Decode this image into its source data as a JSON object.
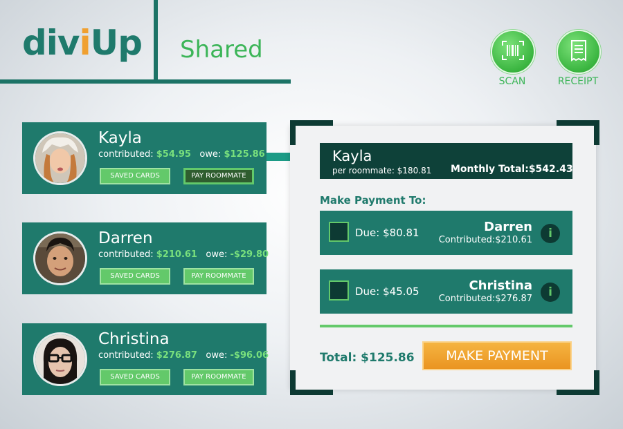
{
  "header": {
    "logo": {
      "part1": "div",
      "accent": "i",
      "part2": "Up"
    },
    "title": "Shared",
    "scan_label": "SCAN",
    "receipt_label": "RECEIPT"
  },
  "roommates": [
    {
      "name": "Kayla",
      "contributed_label": "contributed:",
      "contributed": "$54.95",
      "owe_label": "owe:",
      "owe": "$125.86",
      "saved_cards": "SAVED CARDS",
      "pay_roommate": "PAY ROOMMATE"
    },
    {
      "name": "Darren",
      "contributed_label": "contributed:",
      "contributed": "$210.61",
      "owe_label": "owe:",
      "owe": "-$29.80",
      "saved_cards": "SAVED CARDS",
      "pay_roommate": "PAY ROOMMATE"
    },
    {
      "name": "Christina",
      "contributed_label": "contributed:",
      "contributed": "$276.87",
      "owe_label": "owe:",
      "owe": "-$96.06",
      "saved_cards": "SAVED CARDS",
      "pay_roommate": "PAY ROOMMATE"
    }
  ],
  "payment": {
    "payer_name": "Kayla",
    "per_roommate": "per roommate: $180.81",
    "monthly_total": "Monthly Total:$542.43",
    "make_payment_to": "Make Payment To:",
    "rows": [
      {
        "due": "Due: $80.81",
        "name": "Darren",
        "contributed": "Contributed:$210.61",
        "info": "i"
      },
      {
        "due": "Due: $45.05",
        "name": "Christina",
        "contributed": "Contributed:$276.87",
        "info": "i"
      }
    ],
    "total": "Total: $125.86",
    "make_payment": "MAKE PAYMENT"
  },
  "colors": {
    "brand_teal": "#1f7a6c",
    "dark_teal": "#0e4139",
    "green": "#63c96a",
    "accent_orange": "#f0a030"
  },
  "icons": [
    "barcode-icon",
    "receipt-icon",
    "info-icon"
  ]
}
